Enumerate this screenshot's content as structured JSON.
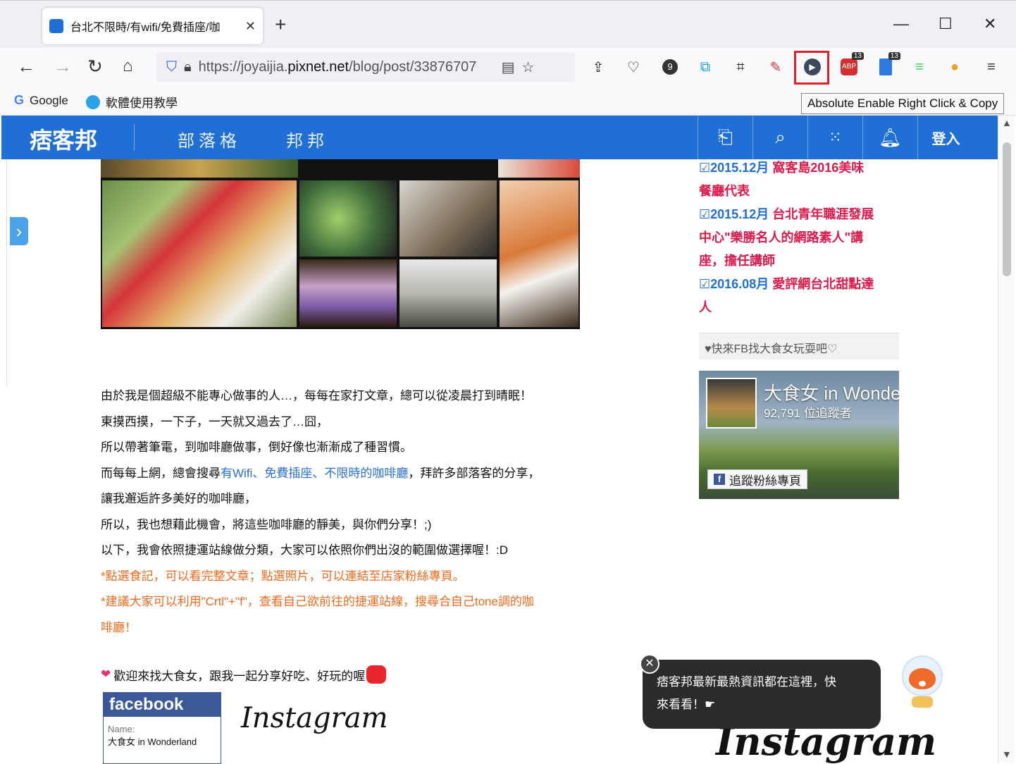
{
  "browser": {
    "tab_title": "台北不限時/有wifi/免費插座/咖",
    "tab_close": "✕",
    "new_tab": "+",
    "window_controls": {
      "minimize": "—",
      "maximize": "☐",
      "close": "✕"
    },
    "url_scheme": "https://joyaijia.",
    "url_domain": "pixnet.net",
    "url_path": "/blog/post/33876707",
    "bookmarks": [
      {
        "label": "Google",
        "icon": "google-icon"
      },
      {
        "label": "軟體使用教學",
        "icon": "software-icon"
      }
    ],
    "tooltip": "Absolute Enable Right Click & Copy",
    "extension_badges": {
      "abp": "13",
      "bookmark": "13",
      "counter": "9"
    }
  },
  "site": {
    "logo": "痞客邦",
    "nav": [
      "部落格",
      "邦邦"
    ],
    "login": "登入"
  },
  "article": {
    "lines": [
      "由於我是個超級不能專心做事的人…，每每在家打文章，總可以從凌晨打到晴眠！",
      "東摸西摸，一下子，一天就又過去了…囧，",
      "所以帶著筆電，到咖啡廳做事，倒好像也漸漸成了種習慣。"
    ],
    "line4_prefix": "而每每上網，總會搜尋",
    "line4_link": "有Wifi、免費插座、不限時的咖啡廳",
    "line4_suffix": "，拜許多部落客的分享，",
    "lines2": [
      "讓我邂逅許多美好的咖啡廳，",
      "所以，我也想藉此機會，將這些咖啡廳的靜美，與你們分享！;)",
      "以下，我會依照捷運站線做分類，大家可以依照你們出沒的範圍做選擇喔！:D"
    ],
    "orange_lines": [
      "*點選食記，可以看完整文章；點選照片，可以連結至店家粉絲專頁。",
      "*建議大家可以利用\"Crtl\"+\"f\"，查看自己欲前往的捷運站線，搜尋合自己tone調的咖",
      "啡廳！"
    ],
    "welcome": "歡迎來找大食女，跟我一起分享好吃、好玩的喔"
  },
  "fb_card": {
    "header": "facebook",
    "name_label": "Name:",
    "name_value": "大食女 in Wonderland"
  },
  "instagram": "Instagram",
  "sidebar": {
    "awards": [
      {
        "mark": "☑2015.12月",
        "text": " 窩客島2016美味"
      },
      {
        "mark": "",
        "text": "餐廳代表"
      },
      {
        "mark": "☑2015.12月",
        "text": " 台北青年職涯發展"
      },
      {
        "mark": "",
        "text": "中心\"樂勝名人的網路素人\"講"
      },
      {
        "mark": "",
        "text": "座，擔任講師"
      },
      {
        "mark": "☑2016.08月",
        "text": " 愛評網台北甜點達"
      },
      {
        "mark": "",
        "text": "人"
      }
    ],
    "fb_box_title": "♥快來FB找大食女玩耍吧♡",
    "fb_widget_name": "大食女 in Wonderland",
    "fb_widget_fans": "92,791 位追蹤者",
    "fb_widget_follow": "追蹤粉絲專頁"
  },
  "notification": {
    "close": "✕",
    "line1": "痞客邦最新最熱資訊都在這裡，快",
    "line2": "來看看！☛"
  },
  "colors": {
    "brand_blue": "#1f6fd6",
    "award_red": "#e0194a",
    "orange_note": "#f36a1c",
    "highlight": "#e31e24"
  }
}
